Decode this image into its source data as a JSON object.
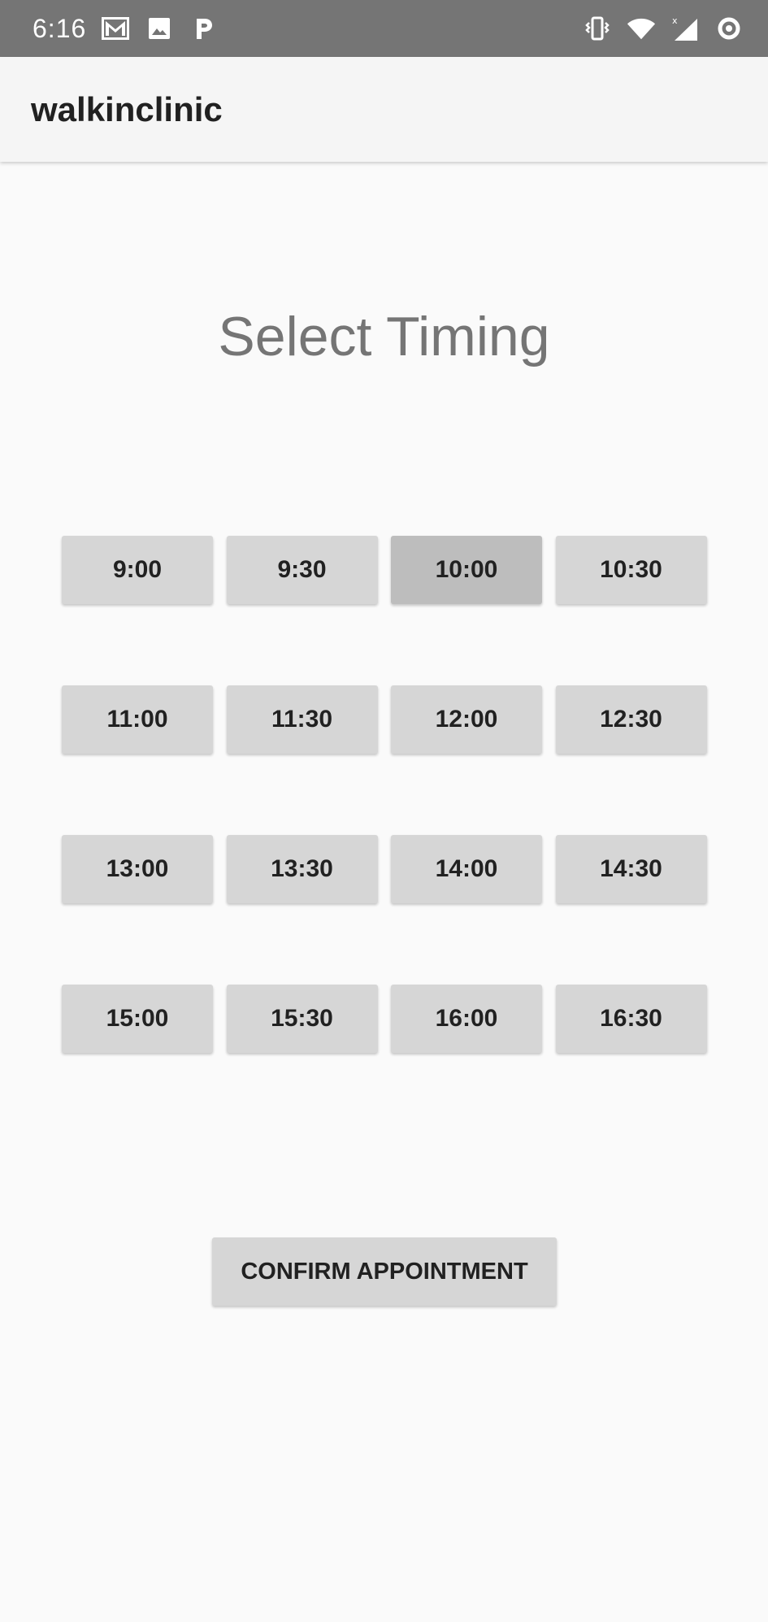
{
  "status_bar": {
    "time": "6:16",
    "left_icons": [
      "gmail-icon",
      "image-icon",
      "parking-icon"
    ],
    "right_icons": [
      "vibrate-icon",
      "wifi-icon",
      "signal-icon",
      "sync-icon"
    ]
  },
  "app_bar": {
    "title": "walkinclinic"
  },
  "main": {
    "heading": "Select Timing",
    "slots": [
      "9:00",
      "9:30",
      "10:00",
      "10:30",
      "11:00",
      "11:30",
      "12:00",
      "12:30",
      "13:00",
      "13:30",
      "14:00",
      "14:30",
      "15:00",
      "15:30",
      "16:00",
      "16:30"
    ],
    "selected_slot": "10:00",
    "confirm_label": "CONFIRM APPOINTMENT"
  },
  "colors": {
    "status_bar": "#757575",
    "app_bar": "#f5f5f5",
    "background": "#fafafa",
    "button": "#d6d6d6",
    "button_selected": "#bdbdbd",
    "heading_text": "#757575"
  }
}
